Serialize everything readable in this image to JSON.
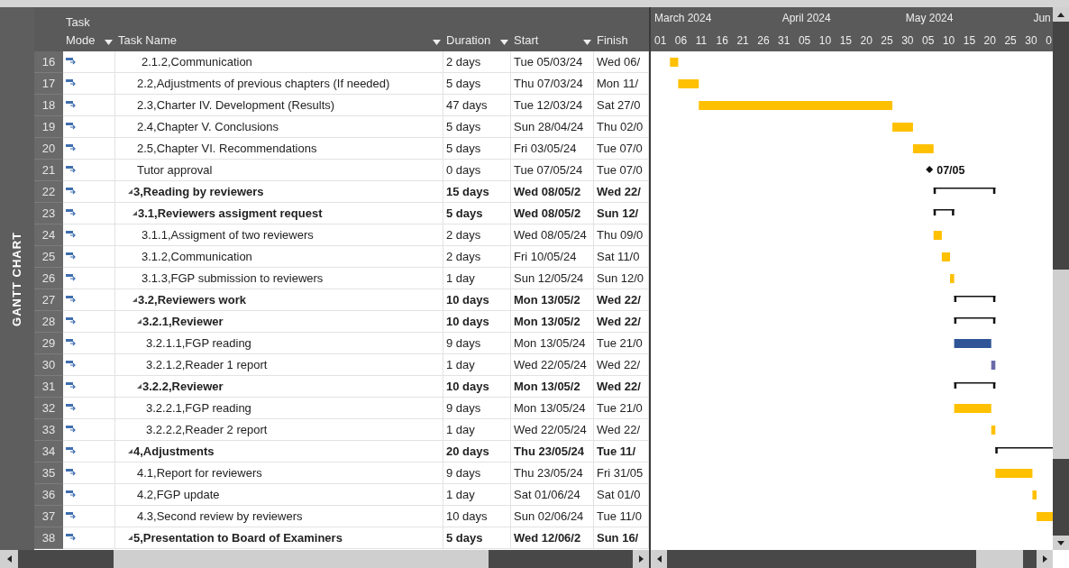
{
  "view_label": "GANTT CHART",
  "columns": [
    {
      "label": "Task Mode",
      "filter": true
    },
    {
      "label": "Task Name",
      "filter": true
    },
    {
      "label": "Duration",
      "filter": true
    },
    {
      "label": "Start",
      "filter": true
    },
    {
      "label": "Finish",
      "filter": false
    }
  ],
  "timescale": {
    "months": [
      "March 2024",
      "April 2024",
      "May 2024",
      "Jun"
    ],
    "days": [
      "01",
      "06",
      "11",
      "16",
      "21",
      "26",
      "31",
      "05",
      "10",
      "15",
      "20",
      "25",
      "30",
      "05",
      "10",
      "15",
      "20",
      "25",
      "30",
      "0"
    ]
  },
  "outline": [
    {
      "children": [
        {
          "children": [
            {
              "id": "16",
              "kind": "task",
              "name": "2.1.2,Communication",
              "duration": "2 days",
              "start": "Tue 05/03/24",
              "finish": "Wed 06/",
              "color": "#ffc000"
            }
          ]
        },
        {
          "id": "17",
          "kind": "task",
          "name": "2.2,Adjustments of previous chapters (If needed)",
          "duration": "5 days",
          "start": "Thu 07/03/24",
          "finish": "Mon 11/",
          "color": "#ffc000"
        },
        {
          "id": "18",
          "kind": "task",
          "name": "2.3,Charter IV. Development (Results)",
          "duration": "47 days",
          "start": "Tue 12/03/24",
          "finish": "Sat 27/0",
          "color": "#ffc000"
        },
        {
          "id": "19",
          "kind": "task",
          "name": "2.4,Chapter V. Conclusions",
          "duration": "5 days",
          "start": "Sun 28/04/24",
          "finish": "Thu 02/0",
          "color": "#ffc000"
        },
        {
          "id": "20",
          "kind": "task",
          "name": "2.5,Chapter VI. Recommendations",
          "duration": "5 days",
          "start": "Fri 03/05/24",
          "finish": "Tue 07/0",
          "color": "#ffc000"
        },
        {
          "id": "21",
          "kind": "milestone",
          "name": "Tutor approval",
          "duration": "0 days",
          "start": "Tue 07/05/24",
          "finish": "Tue 07/0",
          "label": "07/05"
        }
      ]
    },
    {
      "id": "22",
      "kind": "summary",
      "expanded": true,
      "name": "3,Reading by reviewers",
      "duration": "15 days",
      "start": "Wed 08/05/2",
      "finish": "Wed 22/",
      "children": [
        {
          "id": "23",
          "kind": "summary",
          "expanded": true,
          "name": "3.1,Reviewers assigment request",
          "duration": "5 days",
          "start": "Wed 08/05/2",
          "finish": "Sun 12/",
          "children": [
            {
              "id": "24",
              "kind": "task",
              "name": "3.1.1,Assigment of two reviewers",
              "duration": "2 days",
              "start": "Wed 08/05/24",
              "finish": "Thu 09/0",
              "color": "#ffc000"
            },
            {
              "id": "25",
              "kind": "task",
              "name": "3.1.2,Communication",
              "duration": "2 days",
              "start": "Fri 10/05/24",
              "finish": "Sat 11/0",
              "color": "#ffc000"
            },
            {
              "id": "26",
              "kind": "task",
              "name": "3.1.3,FGP submission to reviewers",
              "duration": "1 day",
              "start": "Sun 12/05/24",
              "finish": "Sun 12/0",
              "color": "#ffc000"
            }
          ]
        },
        {
          "id": "27",
          "kind": "summary",
          "expanded": true,
          "name": "3.2,Reviewers work",
          "duration": "10 days",
          "start": "Mon 13/05/2",
          "finish": "Wed 22/",
          "children": [
            {
              "id": "28",
              "kind": "summary",
              "expanded": true,
              "name": "3.2.1,Reviewer",
              "duration": "10 days",
              "start": "Mon 13/05/2",
              "finish": "Wed 22/",
              "children": [
                {
                  "id": "29",
                  "kind": "task",
                  "name": "3.2.1.1,FGP reading",
                  "duration": "9 days",
                  "start": "Mon 13/05/24",
                  "finish": "Tue 21/0",
                  "color": "#2f5597"
                },
                {
                  "id": "30",
                  "kind": "task",
                  "name": "3.2.1.2,Reader 1 report",
                  "duration": "1 day",
                  "start": "Wed 22/05/24",
                  "finish": "Wed 22/",
                  "color": "#6b6baa"
                }
              ]
            },
            {
              "id": "31",
              "kind": "summary",
              "expanded": true,
              "name": "3.2.2,Reviewer",
              "duration": "10 days",
              "start": "Mon 13/05/2",
              "finish": "Wed 22/",
              "children": [
                {
                  "id": "32",
                  "kind": "task",
                  "name": "3.2.2.1,FGP reading",
                  "duration": "9 days",
                  "start": "Mon 13/05/24",
                  "finish": "Tue 21/0",
                  "color": "#ffc000"
                },
                {
                  "id": "33",
                  "kind": "task",
                  "name": "3.2.2.2,Reader 2 report",
                  "duration": "1 day",
                  "start": "Wed 22/05/24",
                  "finish": "Wed 22/",
                  "color": "#ffc000"
                }
              ]
            }
          ]
        }
      ]
    },
    {
      "id": "34",
      "kind": "summary",
      "expanded": true,
      "name": "4,Adjustments",
      "duration": "20 days",
      "start": "Thu 23/05/24",
      "finish": "Tue 11/",
      "children": [
        {
          "id": "35",
          "kind": "task",
          "name": "4.1,Report for reviewers",
          "duration": "9 days",
          "start": "Thu 23/05/24",
          "finish": "Fri 31/05",
          "color": "#ffc000"
        },
        {
          "id": "36",
          "kind": "task",
          "name": "4.2,FGP update",
          "duration": "1 day",
          "start": "Sat 01/06/24",
          "finish": "Sat 01/0",
          "color": "#ffc000"
        },
        {
          "id": "37",
          "kind": "task",
          "name": "4.3,Second review by reviewers",
          "duration": "10 days",
          "start": "Sun 02/06/24",
          "finish": "Tue 11/0",
          "color": "#ffc000"
        }
      ]
    },
    {
      "id": "38",
      "kind": "summary",
      "expanded": true,
      "name": "5,Presentation to Board of Examiners",
      "duration": "5 days",
      "start": "Wed 12/06/2",
      "finish": "Sun 16/"
    }
  ]
}
